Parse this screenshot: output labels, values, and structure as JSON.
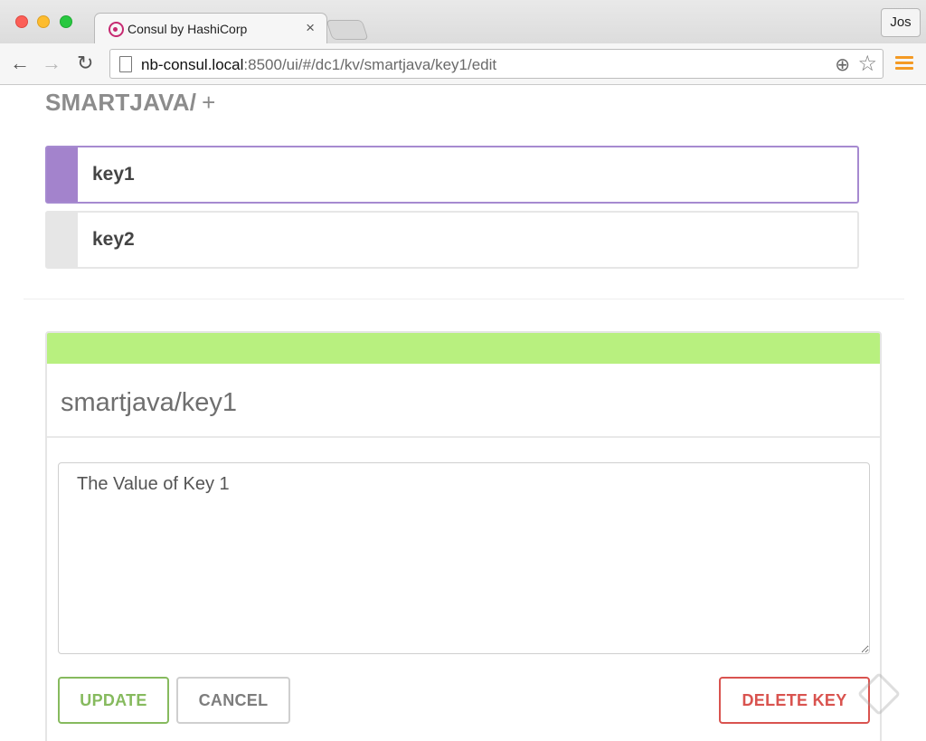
{
  "browser": {
    "tab_title": "Consul by HashiCorp",
    "tab_close": "×",
    "profile_name": "Jos",
    "url_host": "nb-consul.local",
    "url_path": ":8500/ui/#/dc1/kv/smartjava/key1/edit",
    "nav": {
      "back": "←",
      "forward": "→",
      "reload": "↻"
    },
    "zoom_icon": "⊕",
    "star_icon": "☆"
  },
  "kv": {
    "heading": "SMARTJAVA/",
    "add_symbol": "+",
    "keys": [
      {
        "label": "key1",
        "active": true
      },
      {
        "label": "key2",
        "active": false
      }
    ]
  },
  "editor": {
    "title": "smartjava/key1",
    "value": "The Value of Key 1",
    "update_label": "UPDATE",
    "cancel_label": "CANCEL",
    "delete_label": "DELETE KEY"
  },
  "colors": {
    "active_key": "#a383cc",
    "status_bar": "#b8f07f",
    "update": "#86ba5e",
    "delete": "#d9534f",
    "menu": "#f49a24"
  }
}
